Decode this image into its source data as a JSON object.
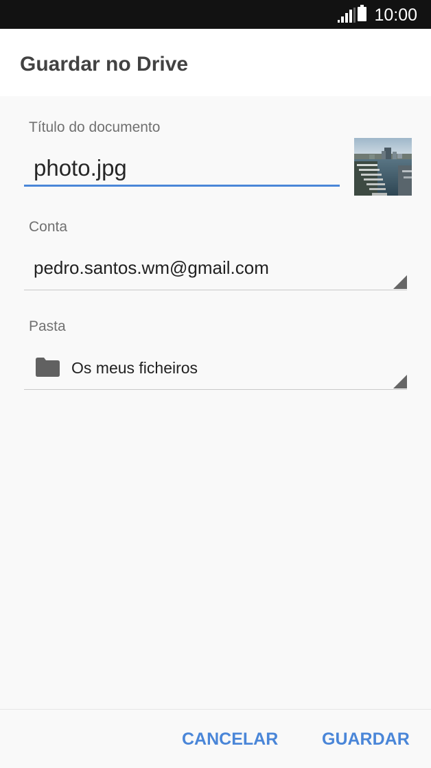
{
  "status_bar": {
    "time": "10:00",
    "icons": [
      "signal-icon",
      "battery-icon"
    ]
  },
  "app_bar": {
    "title": "Guardar no Drive"
  },
  "form": {
    "title_label": "Título do documento",
    "title_value": "photo.jpg",
    "thumbnail_icon": "photo-thumbnail",
    "account_label": "Conta",
    "account_value": "pedro.santos.wm@gmail.com",
    "folder_label": "Pasta",
    "folder_value": "Os meus ficheiros",
    "folder_icon": "folder-icon"
  },
  "actions": {
    "cancel": "CANCELAR",
    "save": "GUARDAR"
  },
  "colors": {
    "accent": "#4a86d8",
    "status_bar": "#121212",
    "background": "#f9f9f9",
    "app_bar": "#ffffff"
  }
}
